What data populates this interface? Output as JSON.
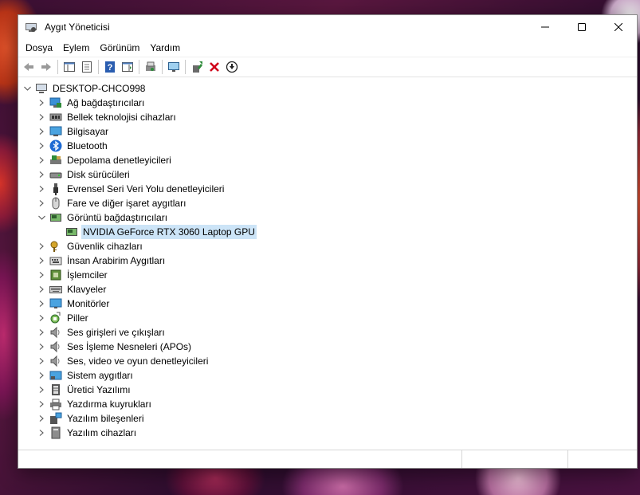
{
  "window": {
    "title": "Aygıt Yöneticisi"
  },
  "menu": [
    "Dosya",
    "Eylem",
    "Görünüm",
    "Yardım"
  ],
  "toolbar": [
    {
      "icon": "back-arrow-icon",
      "enabled": false
    },
    {
      "icon": "forward-arrow-icon",
      "enabled": false
    },
    {
      "icon": "show-hide-console-tree-icon",
      "enabled": true
    },
    {
      "icon": "properties-icon",
      "enabled": true
    },
    {
      "icon": "help-icon",
      "enabled": true
    },
    {
      "icon": "show-action-pane-icon",
      "enabled": true
    },
    {
      "icon": "scan-hardware-icon",
      "enabled": true
    },
    {
      "icon": "monitor-icon",
      "enabled": true
    },
    {
      "icon": "update-driver-icon",
      "enabled": true
    },
    {
      "icon": "uninstall-device-icon",
      "enabled": true
    },
    {
      "icon": "disable-device-icon",
      "enabled": true
    }
  ],
  "tree": {
    "root": "DESKTOP-CHCO998",
    "categories": [
      {
        "label": "Ağ bağdaştırıcıları",
        "icon": "network-icon",
        "expanded": false
      },
      {
        "label": "Bellek teknolojisi cihazları",
        "icon": "memory-icon",
        "expanded": false
      },
      {
        "label": "Bilgisayar",
        "icon": "computer-icon",
        "expanded": false
      },
      {
        "label": "Bluetooth",
        "icon": "bluetooth-icon",
        "expanded": false
      },
      {
        "label": "Depolama denetleyicileri",
        "icon": "storage-icon",
        "expanded": false
      },
      {
        "label": "Disk sürücüleri",
        "icon": "disk-icon",
        "expanded": false
      },
      {
        "label": "Evrensel Seri Veri Yolu denetleyicileri",
        "icon": "usb-icon",
        "expanded": false
      },
      {
        "label": "Fare ve diğer işaret aygıtları",
        "icon": "mouse-icon",
        "expanded": false
      },
      {
        "label": "Görüntü bağdaştırıcıları",
        "icon": "display-adapter-icon",
        "expanded": true,
        "children": [
          {
            "label": "NVIDIA GeForce RTX 3060 Laptop GPU",
            "icon": "display-adapter-icon",
            "selected": true
          }
        ]
      },
      {
        "label": "Güvenlik cihazları",
        "icon": "security-key-icon",
        "expanded": false
      },
      {
        "label": "İnsan Arabirim Aygıtları",
        "icon": "hid-icon",
        "expanded": false
      },
      {
        "label": "İşlemciler",
        "icon": "processor-icon",
        "expanded": false
      },
      {
        "label": "Klavyeler",
        "icon": "keyboard-icon",
        "expanded": false
      },
      {
        "label": "Monitörler",
        "icon": "monitor-icon",
        "expanded": false
      },
      {
        "label": "Piller",
        "icon": "battery-icon",
        "expanded": false
      },
      {
        "label": "Ses girişleri ve çıkışları",
        "icon": "speaker-icon",
        "expanded": false
      },
      {
        "label": "Ses İşleme Nesneleri (APOs)",
        "icon": "speaker-icon",
        "expanded": false
      },
      {
        "label": "Ses, video ve oyun denetleyicileri",
        "icon": "speaker-icon",
        "expanded": false
      },
      {
        "label": "Sistem aygıtları",
        "icon": "system-devices-icon",
        "expanded": false
      },
      {
        "label": "Üretici Yazılımı",
        "icon": "firmware-icon",
        "expanded": false
      },
      {
        "label": "Yazdırma kuyrukları",
        "icon": "printer-icon",
        "expanded": false
      },
      {
        "label": "Yazılım bileşenleri",
        "icon": "software-component-icon",
        "expanded": false
      },
      {
        "label": "Yazılım cihazları",
        "icon": "software-device-icon",
        "expanded": false
      }
    ]
  },
  "colors": {
    "selection": "#cce4f7",
    "accent_blue": "#1f6fc4",
    "uninstall_red": "#d0021b",
    "update_green": "#2e8b3a"
  }
}
